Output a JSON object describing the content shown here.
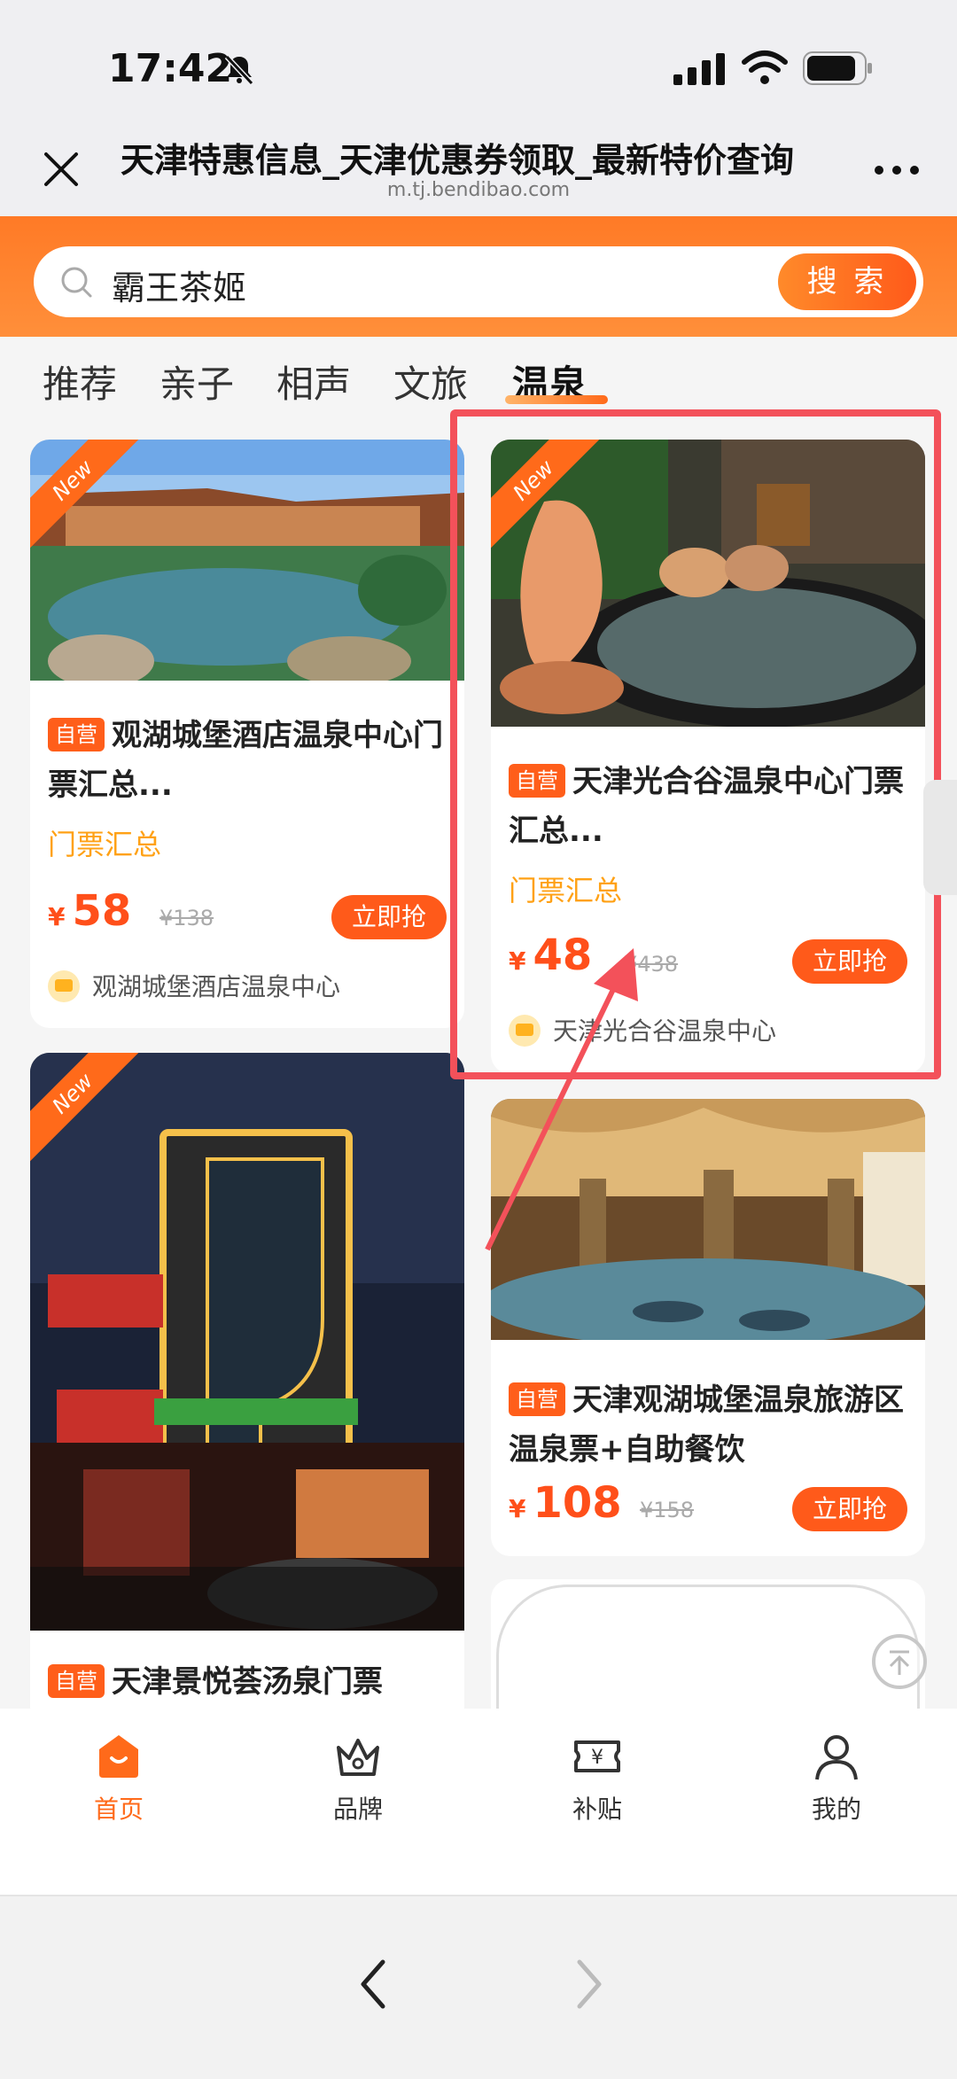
{
  "status": {
    "time": "17:42"
  },
  "browser": {
    "title": "天津特惠信息_天津优惠券领取_最新特价查询",
    "url": "m.tj.bendibao.com"
  },
  "search": {
    "query": "霸王茶姬",
    "button": "搜 索"
  },
  "tabs": [
    {
      "label": "推荐"
    },
    {
      "label": "亲子"
    },
    {
      "label": "相声"
    },
    {
      "label": "文旅"
    },
    {
      "label": "温泉",
      "active": true
    }
  ],
  "cards": [
    {
      "badge": "New",
      "tag": "自营",
      "title": "观湖城堡酒店温泉中心门票汇总...",
      "subtitle": "门票汇总",
      "currency": "¥",
      "price": "58",
      "original": "¥138",
      "button": "立即抢",
      "shop": "观湖城堡酒店温泉中心"
    },
    {
      "badge": "New",
      "tag": "自营",
      "title": "天津光合谷温泉中心门票汇总...",
      "subtitle": "门票汇总",
      "currency": "¥",
      "price": "48",
      "original": "¥438",
      "button": "立即抢",
      "shop": "天津光合谷温泉中心"
    },
    {
      "badge": "New",
      "tag": "自营",
      "title": "天津景悦荟汤泉门票"
    },
    {
      "tag": "自营",
      "title": "天津观湖城堡温泉旅游区温泉票+自助餐饮",
      "currency": "¥",
      "price": "108",
      "original": "¥158",
      "button": "立即抢"
    }
  ],
  "bottom_nav": [
    {
      "label": "首页",
      "icon": "home-icon",
      "active": true
    },
    {
      "label": "品牌",
      "icon": "crown-icon"
    },
    {
      "label": "补贴",
      "icon": "coupon-icon"
    },
    {
      "label": "我的",
      "icon": "user-icon"
    }
  ],
  "colors": {
    "accent": "#ff6a1a",
    "highlight": "#f3515a",
    "subtitle": "#ffa115"
  }
}
